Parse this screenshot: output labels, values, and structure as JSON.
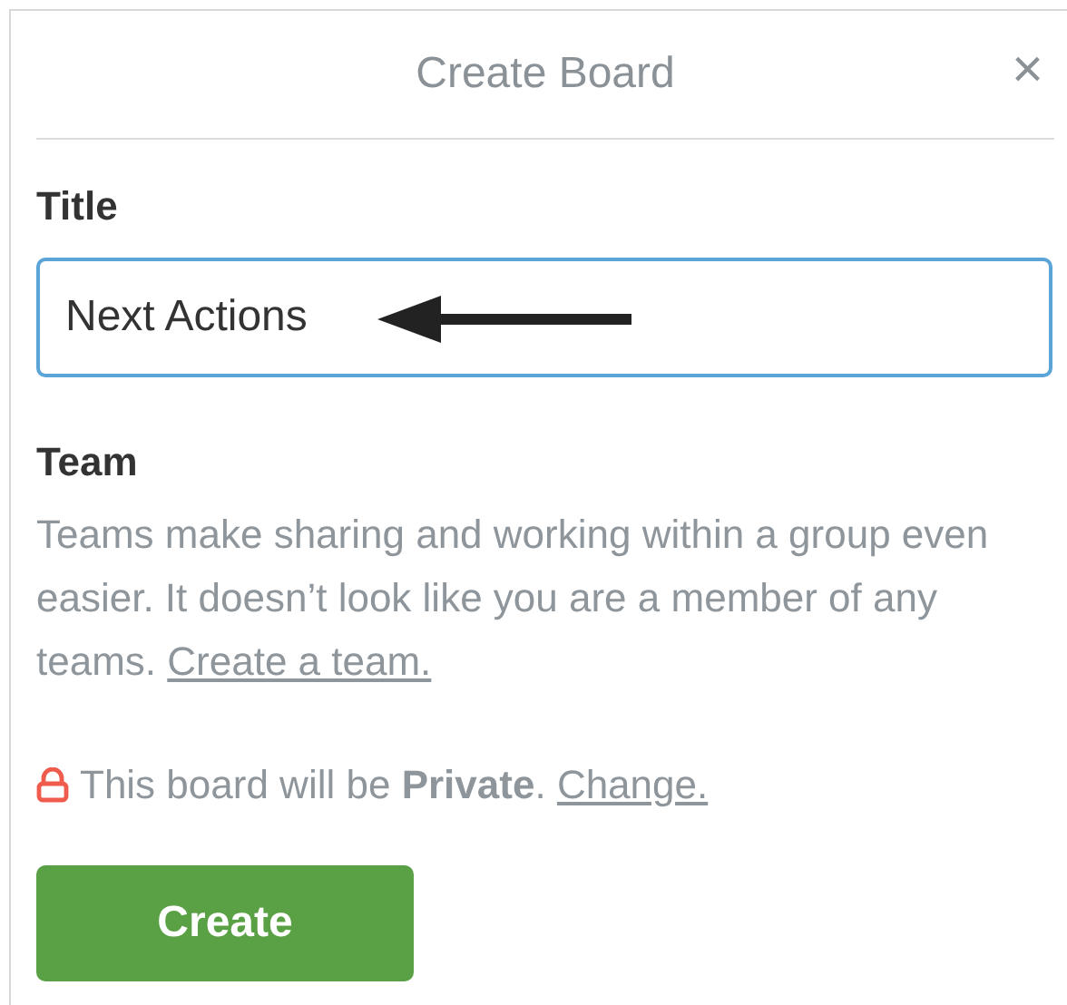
{
  "dialog": {
    "title": "Create Board",
    "close": "×"
  },
  "title_field": {
    "label": "Title",
    "value": "Next Actions"
  },
  "team": {
    "label": "Team",
    "description": "Teams make sharing and working within a group even easier. It doesn’t look like you are a member of any teams.",
    "link": "Create a team."
  },
  "visibility": {
    "text": "This board will be **Private**.",
    "link": "Change."
  },
  "buttons": [
    "Create"
  ]
}
